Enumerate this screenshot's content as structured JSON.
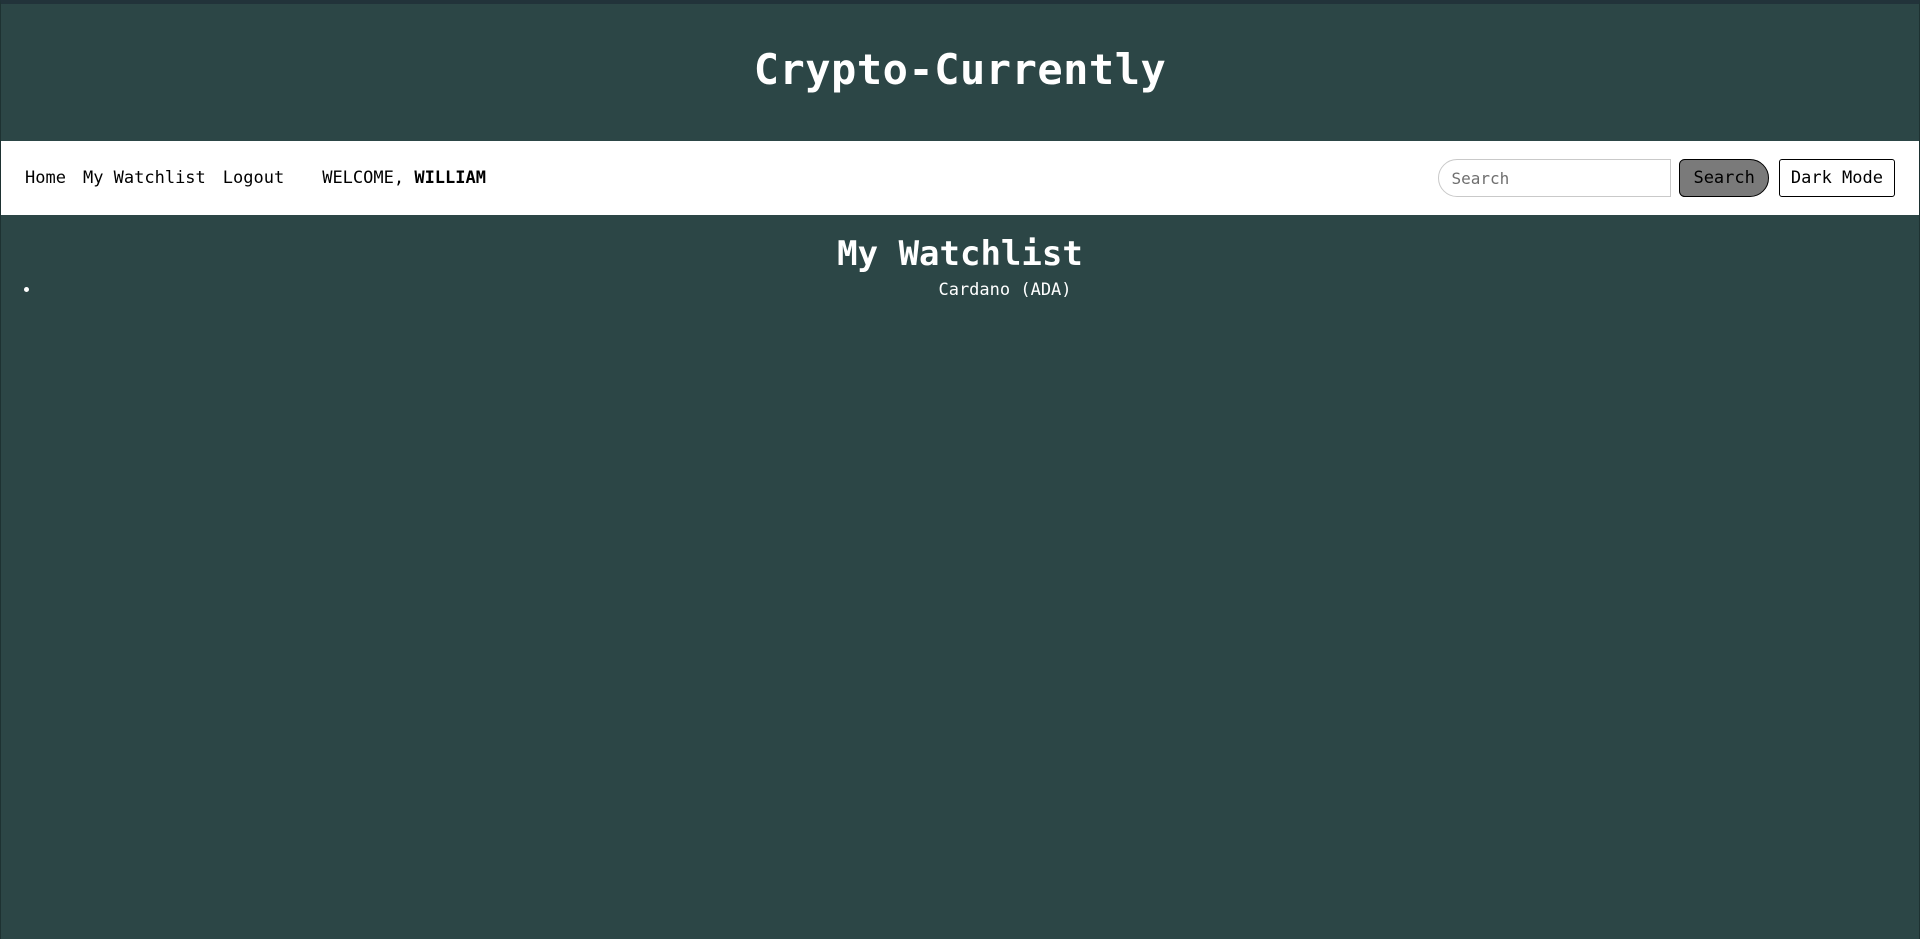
{
  "site": {
    "title": "Crypto-Currently"
  },
  "nav": {
    "links": [
      {
        "label": "Home"
      },
      {
        "label": "My Watchlist"
      },
      {
        "label": "Logout"
      }
    ],
    "welcome_prefix": "WELCOME, ",
    "welcome_name": "WILLIAM",
    "search": {
      "placeholder": "Search",
      "value": "",
      "button_label": "Search"
    },
    "dark_mode_label": "Dark Mode"
  },
  "main": {
    "heading": "My Watchlist",
    "watchlist": [
      {
        "label": "Cardano (ADA)"
      }
    ]
  },
  "colors": {
    "page_background": "#2c4646",
    "navbar_background": "#ffffff",
    "search_button_background": "#7a7a7a",
    "text_light": "#ffffff",
    "text_dark": "#000000"
  }
}
